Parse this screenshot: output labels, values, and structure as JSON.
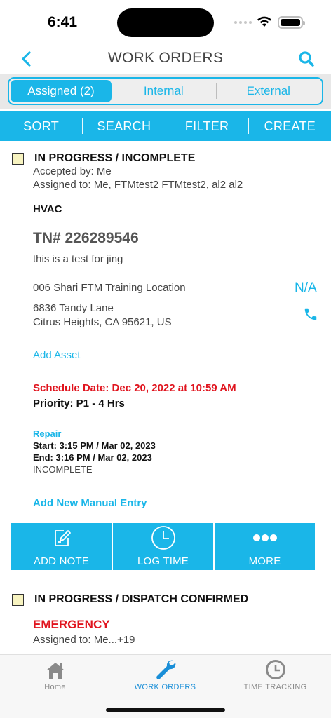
{
  "status_bar": {
    "time": "6:41"
  },
  "header": {
    "title": "WORK ORDERS"
  },
  "segments": [
    {
      "label": "Assigned (2)",
      "active": true
    },
    {
      "label": "Internal",
      "active": false
    },
    {
      "label": "External",
      "active": false
    }
  ],
  "actions": [
    "SORT",
    "SEARCH",
    "FILTER",
    "CREATE"
  ],
  "orders": [
    {
      "status": "IN PROGRESS / INCOMPLETE",
      "accepted_by": "Accepted by:  Me",
      "assigned_to": "Assigned to:  Me, FTMtest2 FTMtest2, al2 al2",
      "trade": "HVAC",
      "tn": "TN# 226289546",
      "description": "this is a test for jing",
      "location": "006 Shari FTM Training Location",
      "na": "N/A",
      "address1": "6836 Tandy Lane",
      "address2": "Citrus Heights, CA 95621, US",
      "add_asset": "Add Asset",
      "schedule_date": "Schedule Date: Dec 20, 2022 at 10:59 AM",
      "priority": "Priority:  P1 - 4 Hrs",
      "entry": {
        "type": "Repair",
        "start": "Start: 3:15 PM / Mar 02, 2023",
        "end": "End: 3:16 PM / Mar 02, 2023",
        "status": "INCOMPLETE"
      },
      "add_manual_entry": "Add New Manual Entry",
      "buttons": {
        "add_note": "ADD NOTE",
        "log_time": "LOG TIME",
        "more": "MORE"
      }
    },
    {
      "status": "IN PROGRESS / DISPATCH CONFIRMED",
      "trade": "EMERGENCY",
      "assigned_to": "Assigned to:  Me...+19"
    }
  ],
  "tabbar": [
    {
      "label": "Home",
      "icon": "home-icon"
    },
    {
      "label": "WORK ORDERS",
      "icon": "wrench-icon",
      "active": true
    },
    {
      "label": "TIME TRACKING",
      "icon": "clock-icon"
    }
  ],
  "colors": {
    "accent": "#1ab6e8",
    "alert": "#e0141e",
    "checkbox": "#f7f3c0"
  }
}
